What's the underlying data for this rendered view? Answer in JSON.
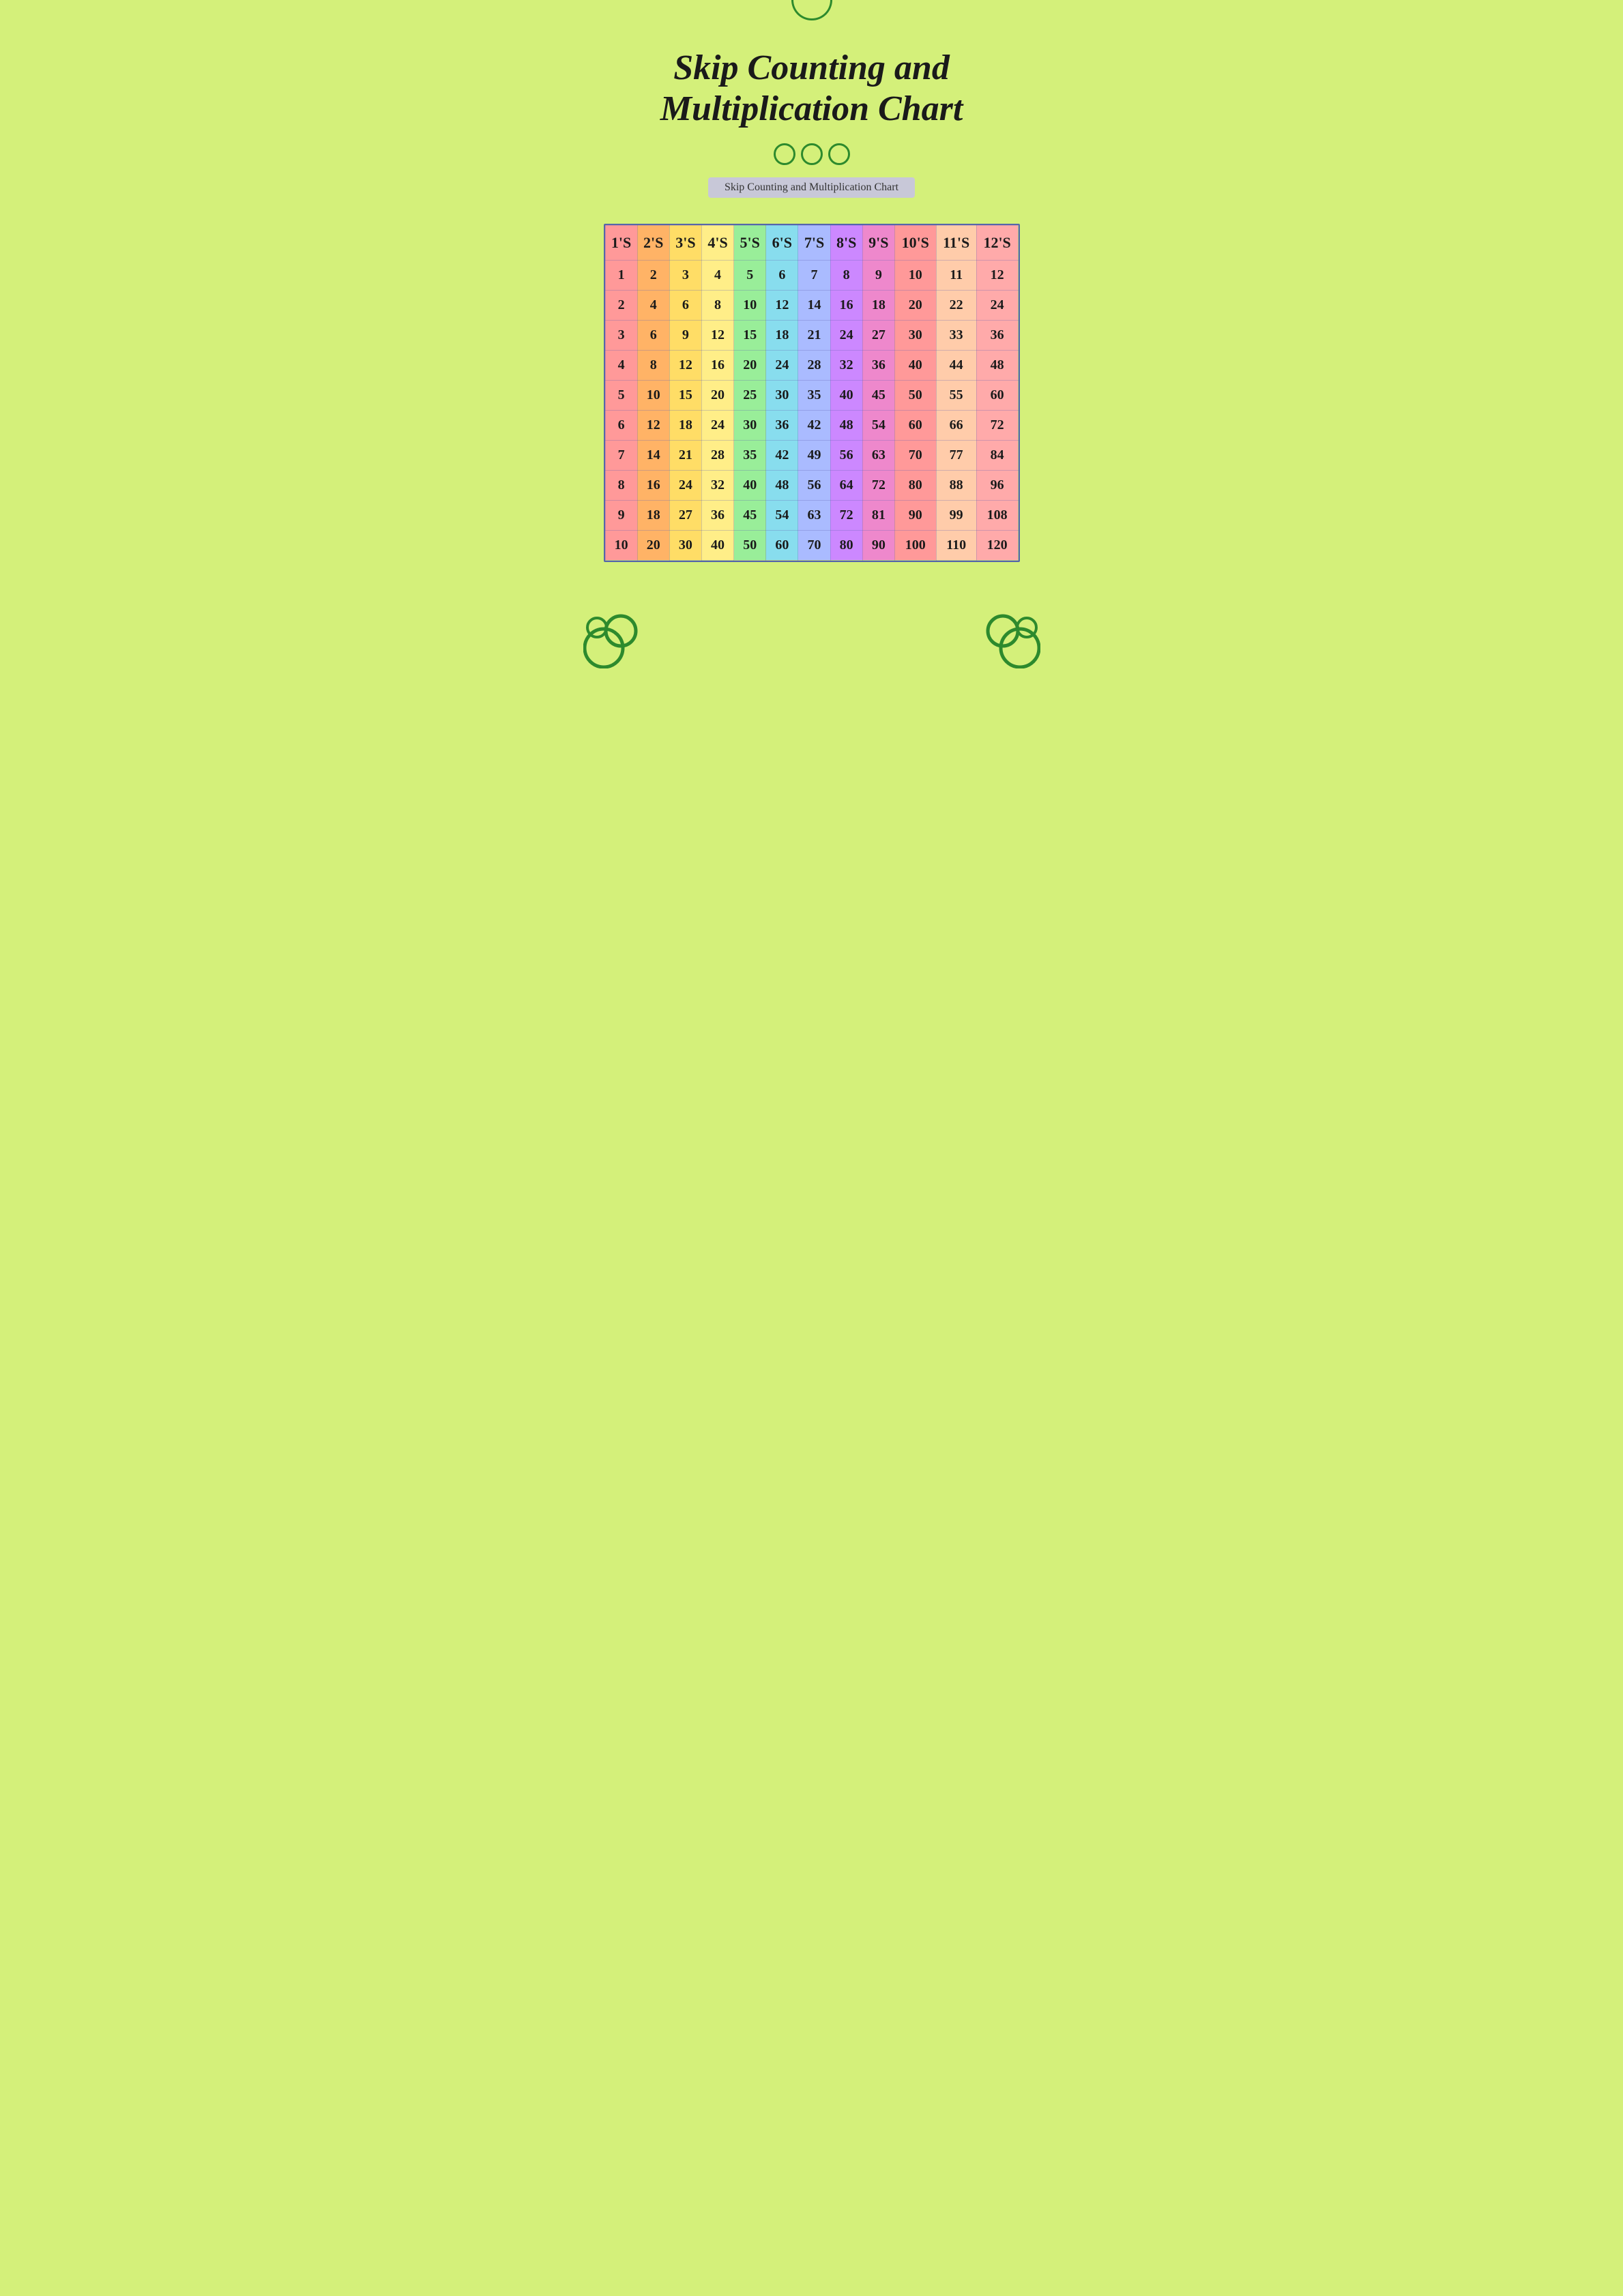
{
  "page": {
    "background_color": "#d4f07a",
    "title": "Skip Counting and Multiplication Chart",
    "subtitle": "Skip Counting and Multiplication Chart",
    "circles_decoration": [
      "○",
      "○",
      "○"
    ],
    "table": {
      "headers": [
        "1'S",
        "2'S",
        "3'S",
        "4'S",
        "5'S",
        "6'S",
        "7'S",
        "8'S",
        "9'S",
        "10'S",
        "11'S",
        "12'S"
      ],
      "rows": [
        [
          1,
          2,
          3,
          4,
          5,
          6,
          7,
          8,
          9,
          10,
          11,
          12
        ],
        [
          2,
          4,
          6,
          8,
          10,
          12,
          14,
          16,
          18,
          20,
          22,
          24
        ],
        [
          3,
          6,
          9,
          12,
          15,
          18,
          21,
          24,
          27,
          30,
          33,
          36
        ],
        [
          4,
          8,
          12,
          16,
          20,
          24,
          28,
          32,
          36,
          40,
          44,
          48
        ],
        [
          5,
          10,
          15,
          20,
          25,
          30,
          35,
          40,
          45,
          50,
          55,
          60
        ],
        [
          6,
          12,
          18,
          24,
          30,
          36,
          42,
          48,
          54,
          60,
          66,
          72
        ],
        [
          7,
          14,
          21,
          28,
          35,
          42,
          49,
          56,
          63,
          70,
          77,
          84
        ],
        [
          8,
          16,
          24,
          32,
          40,
          48,
          56,
          64,
          72,
          80,
          88,
          96
        ],
        [
          9,
          18,
          27,
          36,
          45,
          54,
          63,
          72,
          81,
          90,
          99,
          108
        ],
        [
          10,
          20,
          30,
          40,
          50,
          60,
          70,
          80,
          90,
          100,
          110,
          120
        ]
      ]
    }
  }
}
